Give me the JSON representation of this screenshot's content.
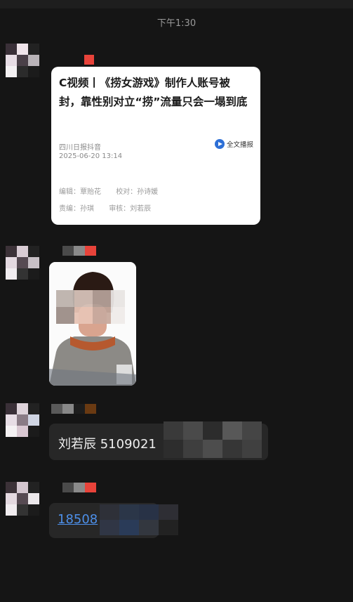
{
  "status_bar": {
    "time": "下午1:30"
  },
  "messages": [
    {
      "type": "article_card",
      "article": {
        "title": "C视频丨《捞女游戏》制作人账号被封，靠性别对立“捞”流量只会一塌到底",
        "source": "四川日报抖音",
        "date": "2025-06-20 13:14",
        "play_label": "全文播报",
        "editor": "编辑：覃贻花",
        "proofreader": "校对：孙诗媛",
        "responsible": "责编：孙琪",
        "reviewer": "审核：刘若辰"
      }
    },
    {
      "type": "photo"
    },
    {
      "type": "text",
      "text": "刘若辰 5109021"
    },
    {
      "type": "link",
      "text": "18508"
    }
  ],
  "colors": {
    "background": "#151515",
    "bubble": "#272727",
    "link": "#4d8fe8",
    "card": "#ffffff"
  }
}
